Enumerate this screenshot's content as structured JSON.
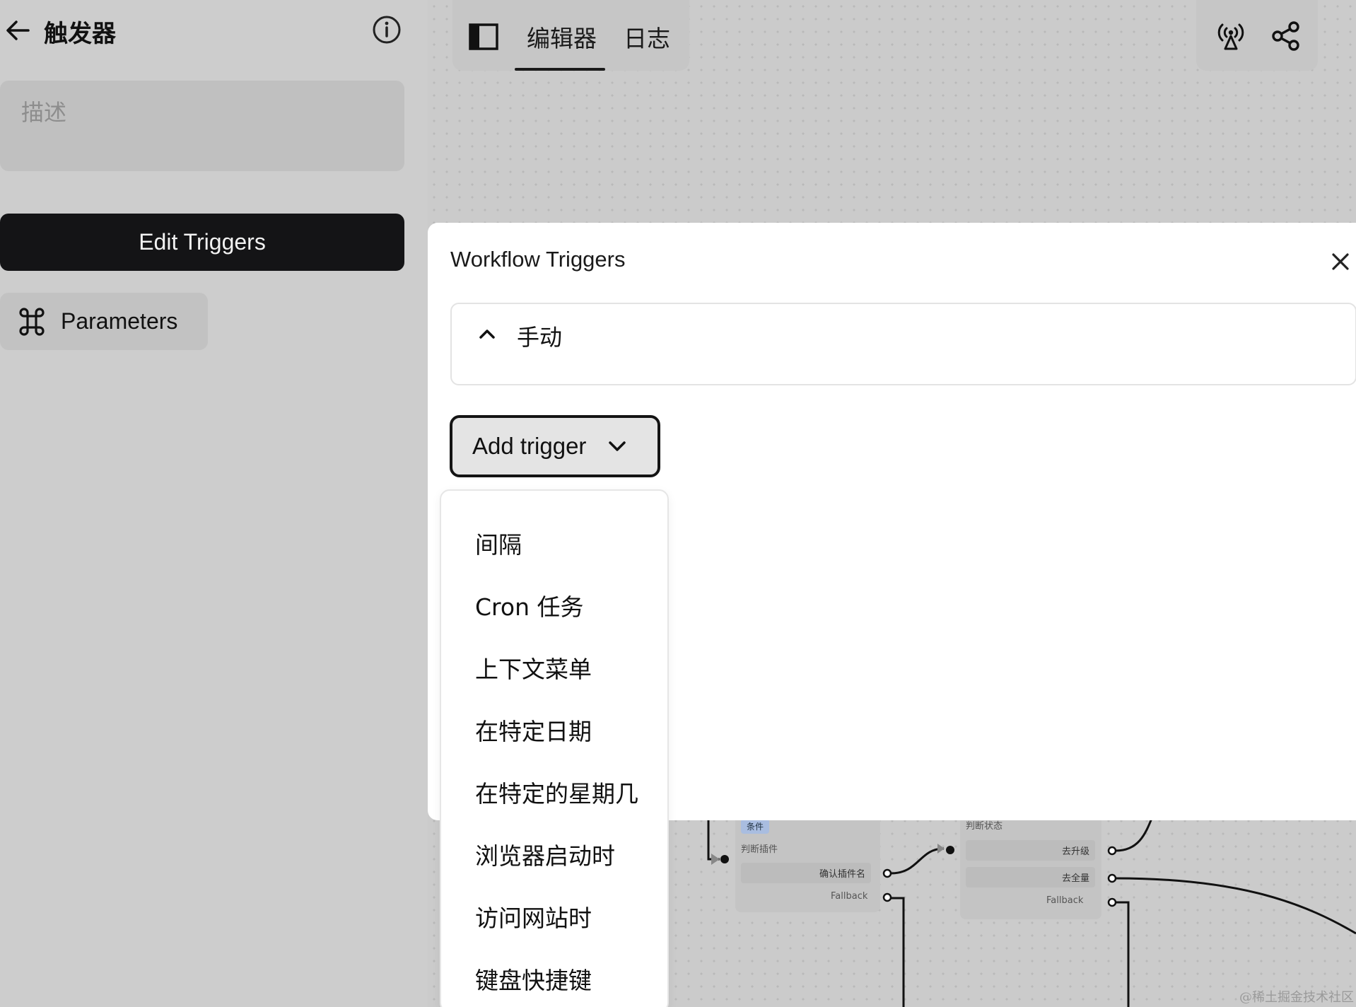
{
  "sidebar": {
    "title": "触发器",
    "description_placeholder": "描述",
    "edit_triggers_label": "Edit Triggers",
    "parameters_label": "Parameters"
  },
  "toolbar": {
    "tabs": [
      {
        "label": "编辑器",
        "active": true
      },
      {
        "label": "日志",
        "active": false
      }
    ]
  },
  "workflow": {
    "node1": {
      "badge": "条件",
      "label": "判断插件",
      "field": "确认插件名",
      "fallback": "Fallback"
    },
    "node2": {
      "label": "判断状态",
      "fields": [
        "去升级",
        "去全量"
      ],
      "fallback": "Fallback"
    }
  },
  "modal": {
    "title": "Workflow Triggers",
    "accordion_label": "手动",
    "add_trigger_label": "Add trigger"
  },
  "dropdown": {
    "items": [
      "间隔",
      "Cron 任务",
      "上下文菜单",
      "在特定日期",
      "在特定的星期几",
      "浏览器启动时",
      "访问网站时",
      "键盘快捷键"
    ]
  },
  "watermark": "@稀土掘金技术社区",
  "colors": {
    "primary_button": "#141416",
    "background": "#cbcbcb",
    "modal": "#ffffff"
  },
  "icons": [
    "back-arrow-icon",
    "info-icon",
    "command-icon",
    "sidebar-toggle-icon",
    "broadcast-icon",
    "share-icon",
    "close-icon",
    "chevron-up-icon",
    "chevron-down-icon"
  ]
}
